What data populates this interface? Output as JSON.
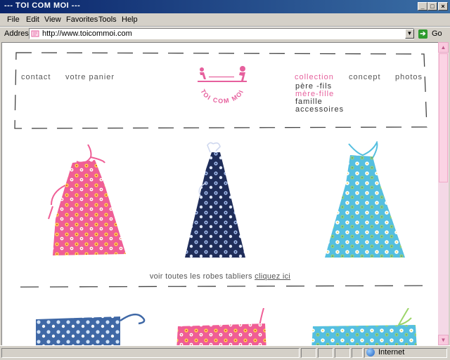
{
  "window": {
    "title": "--- TOI COM MOI ---",
    "minimize_glyph": "_",
    "maximize_glyph": "□",
    "close_glyph": "×"
  },
  "menu": {
    "items": [
      "File",
      "Edit",
      "View",
      "Favorites",
      "Tools",
      "Help"
    ]
  },
  "address": {
    "label": "Address",
    "url": "http://www.toicommoi.com",
    "go_label": "Go"
  },
  "site": {
    "logo_text": "TOI COM MOI",
    "nav_left": [
      "contact",
      "votre panier"
    ],
    "nav_right": [
      "collection",
      "concept",
      "photos"
    ],
    "submenu": [
      "père -fils",
      "mère-fille",
      "famille",
      "accessoires"
    ],
    "bottom_text": "voir toutes les robes tabliers",
    "bottom_link": "cliquez ici"
  },
  "status": {
    "zone": "Internet"
  },
  "colors": {
    "accent_pink": "#e6609d",
    "dress_pink": "#ef5e96",
    "dress_navy": "#1f2d59",
    "dress_sky": "#55bfe0"
  },
  "icons": {
    "favicon": "ie-page-icon",
    "go": "go-arrow-icon",
    "zone": "internet-globe-icon"
  }
}
